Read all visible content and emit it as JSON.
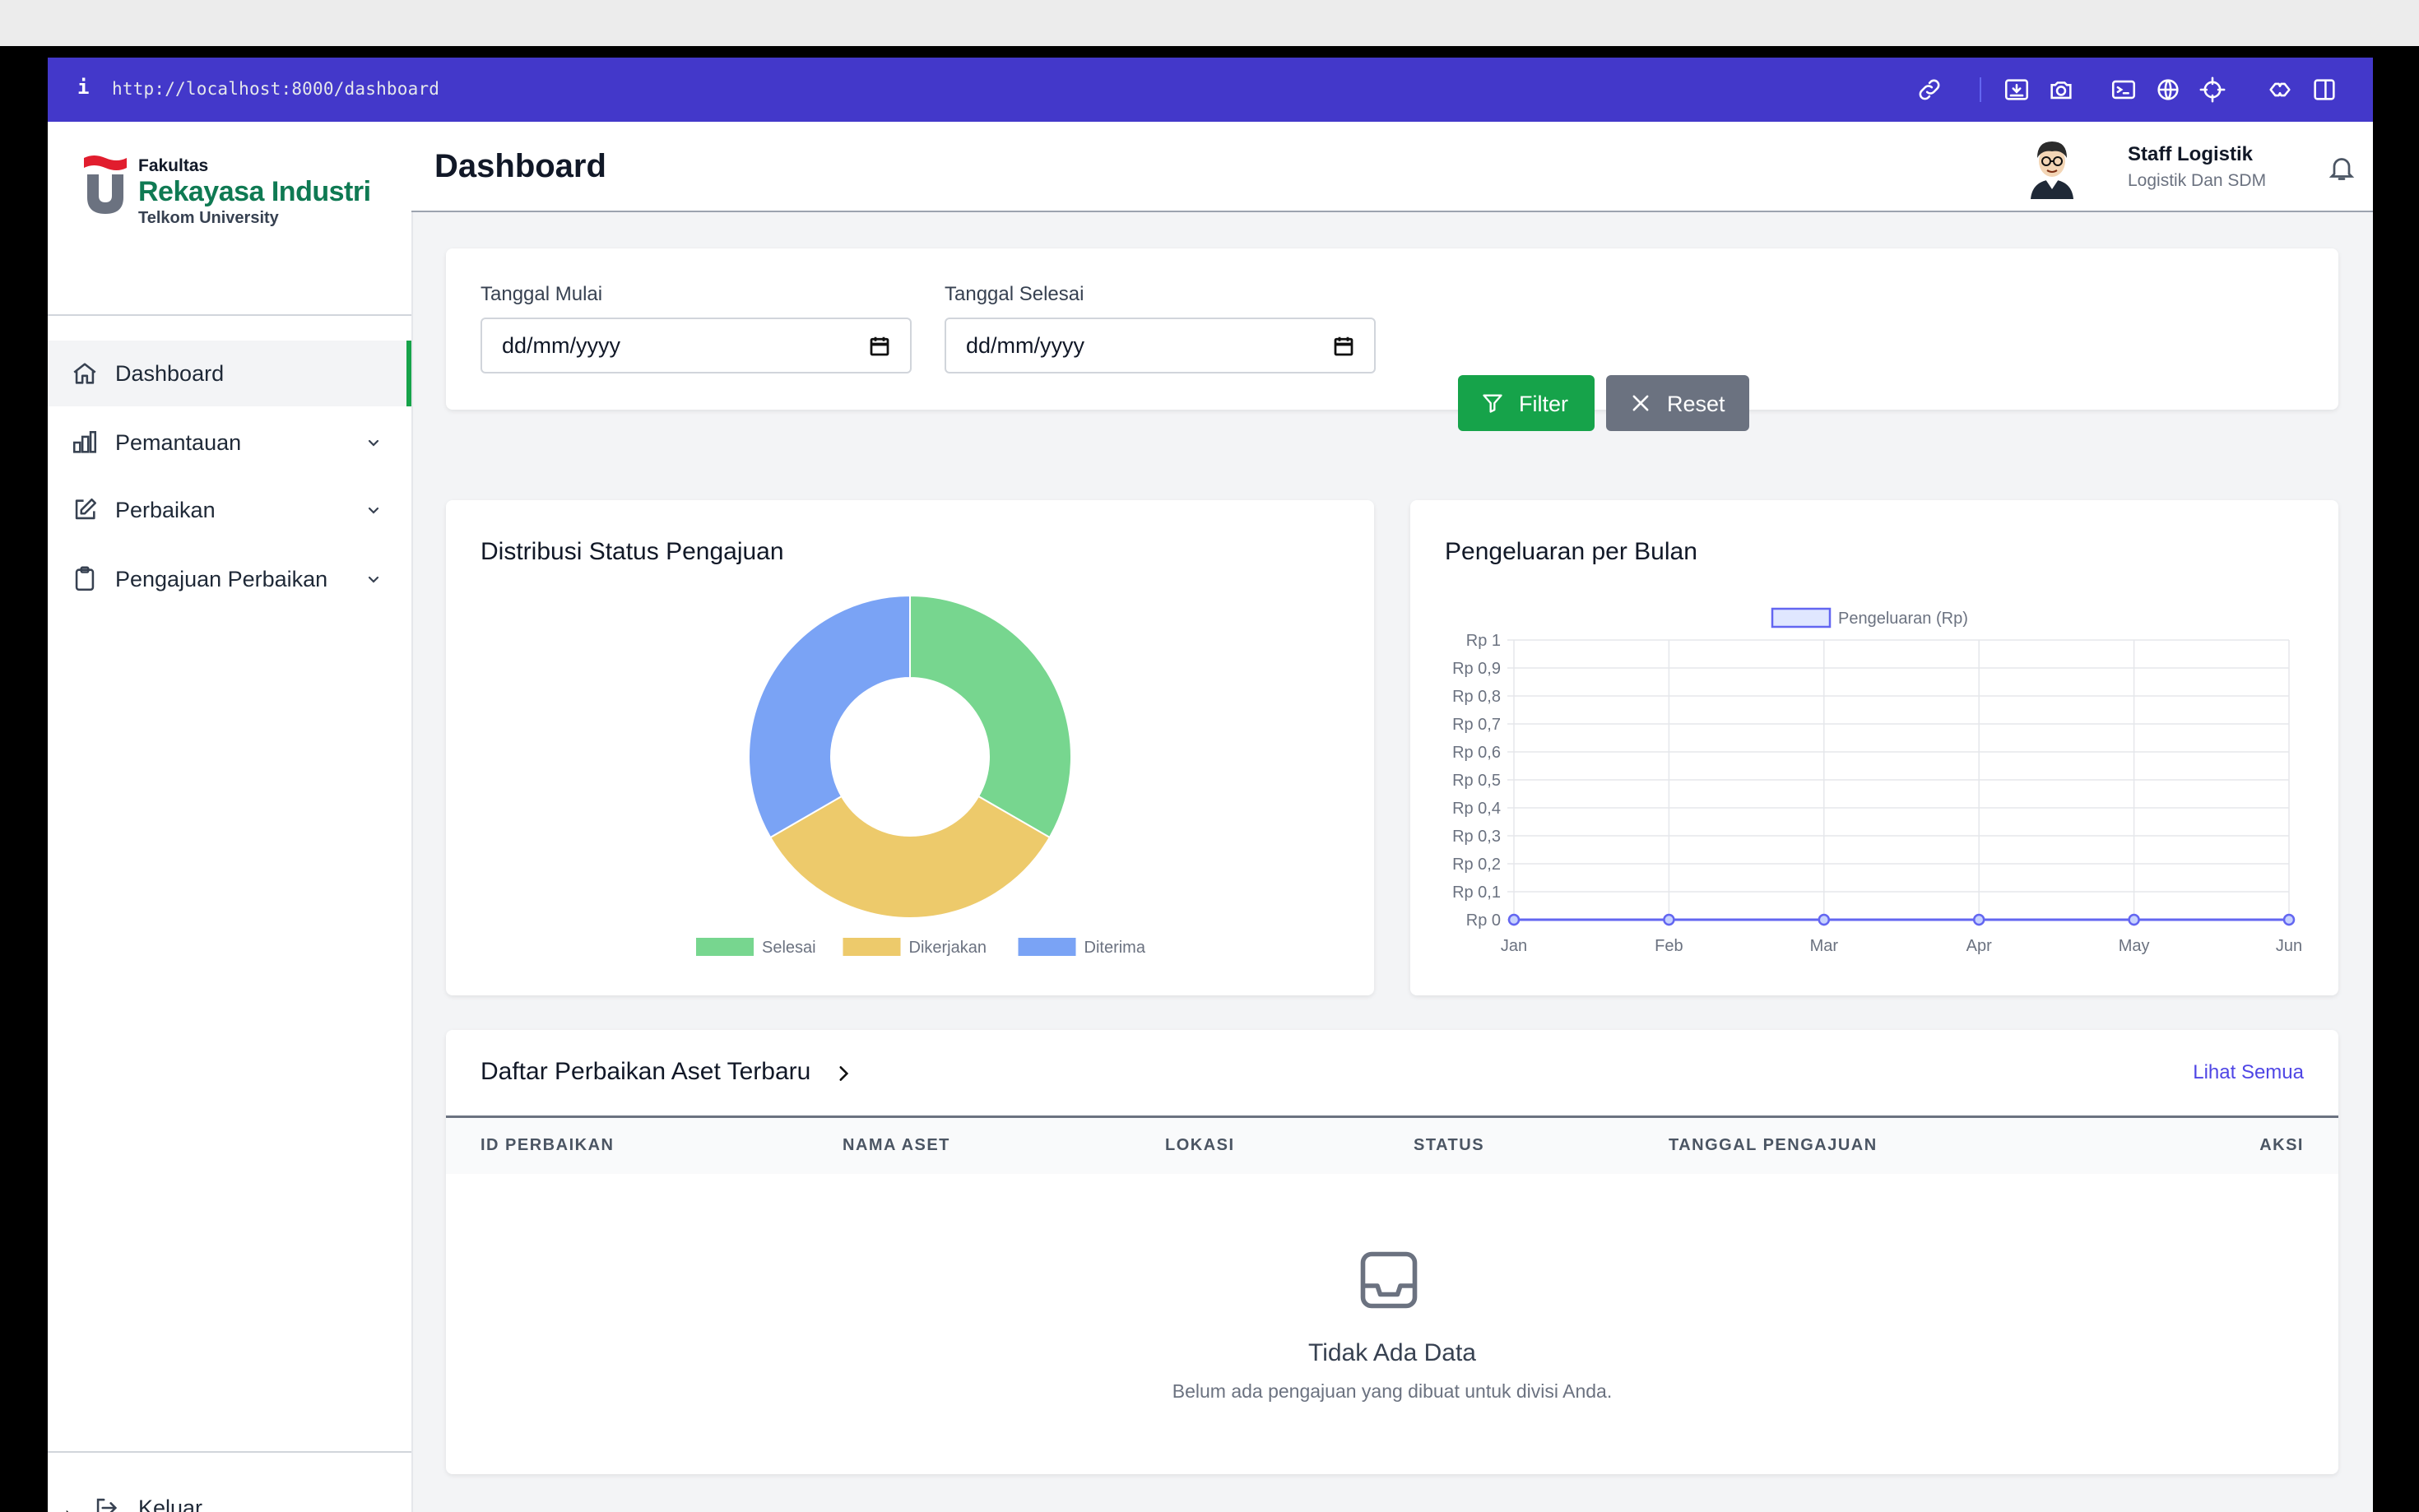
{
  "browser": {
    "url": "http://localhost:8000/dashboard"
  },
  "brand": {
    "line1": "Fakultas",
    "line2": "Rekayasa Industri",
    "line3": "Telkom University",
    "red": "#e11d2e",
    "green": "#0f7a53"
  },
  "sidebar": {
    "items": [
      {
        "label": "Dashboard"
      },
      {
        "label": "Pemantauan"
      },
      {
        "label": "Perbaikan"
      },
      {
        "label": "Pengajuan Perbaikan"
      }
    ],
    "logout_label": "Keluar"
  },
  "header": {
    "title": "Dashboard",
    "user_name": "Staff Logistik",
    "user_role": "Logistik Dan SDM"
  },
  "filters": {
    "start_label": "Tanggal Mulai",
    "end_label": "Tanggal Selesai",
    "date_placeholder": "dd/mm/yyyy",
    "filter_button": "Filter",
    "reset_button": "Reset"
  },
  "charts": {
    "donut_title": "Distribusi Status Pengajuan",
    "line_title": "Pengeluaran per Bulan"
  },
  "chart_data": [
    {
      "type": "pie",
      "title": "Distribusi Status Pengajuan",
      "categories": [
        "Selesai",
        "Dikerjakan",
        "Diterima"
      ],
      "values": [
        1,
        1,
        1
      ],
      "colors": [
        "#77d68f",
        "#edca6b",
        "#7aa3f5"
      ],
      "legend": "bottom"
    },
    {
      "type": "line",
      "title": "Pengeluaran per Bulan",
      "categories": [
        "Jan",
        "Feb",
        "Mar",
        "Apr",
        "May",
        "Jun"
      ],
      "series": [
        {
          "name": "Pengeluaran (Rp)",
          "values": [
            0,
            0,
            0,
            0,
            0,
            0
          ],
          "color": "#6366f1"
        }
      ],
      "yticks": [
        "Rp 0",
        "Rp 0,1",
        "Rp 0,2",
        "Rp 0,3",
        "Rp 0,4",
        "Rp 0,5",
        "Rp 0,6",
        "Rp 0,7",
        "Rp 0,8",
        "Rp 0,9",
        "Rp 1"
      ],
      "ylim": [
        0,
        1
      ],
      "grid": true,
      "legend": "top"
    }
  ],
  "table": {
    "title": "Daftar Perbaikan Aset Terbaru",
    "view_all": "Lihat Semua",
    "columns": [
      "ID PERBAIKAN",
      "NAMA ASET",
      "LOKASI",
      "STATUS",
      "TANGGAL PENGAJUAN",
      "AKSI"
    ],
    "empty_title": "Tidak Ada Data",
    "empty_subtitle": "Belum ada pengajuan yang dibuat untuk divisi Anda."
  }
}
